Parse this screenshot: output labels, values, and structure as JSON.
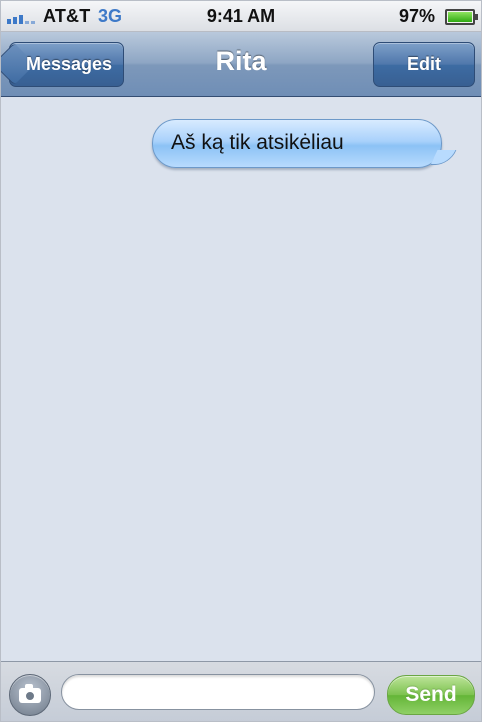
{
  "status_bar": {
    "carrier": "AT&T",
    "network": "3G",
    "time": "9:41 AM",
    "battery": "97%",
    "icons": {
      "signal": "signal-bars-icon",
      "battery": "battery-icon"
    }
  },
  "nav": {
    "back_label": "Messages",
    "title": "Rita",
    "edit_label": "Edit"
  },
  "messages": [
    {
      "text": "Aš ką tik atsikėliau",
      "direction": "outgoing"
    }
  ],
  "input": {
    "placeholder": "",
    "value": "",
    "send_label": "Send",
    "camera_icon": "camera-icon"
  },
  "colors": {
    "nav_bar": "#7d98ba",
    "outgoing_bubble": "#a9d1fb",
    "send_button": "#7cc24f",
    "background": "#dbe2ed"
  }
}
